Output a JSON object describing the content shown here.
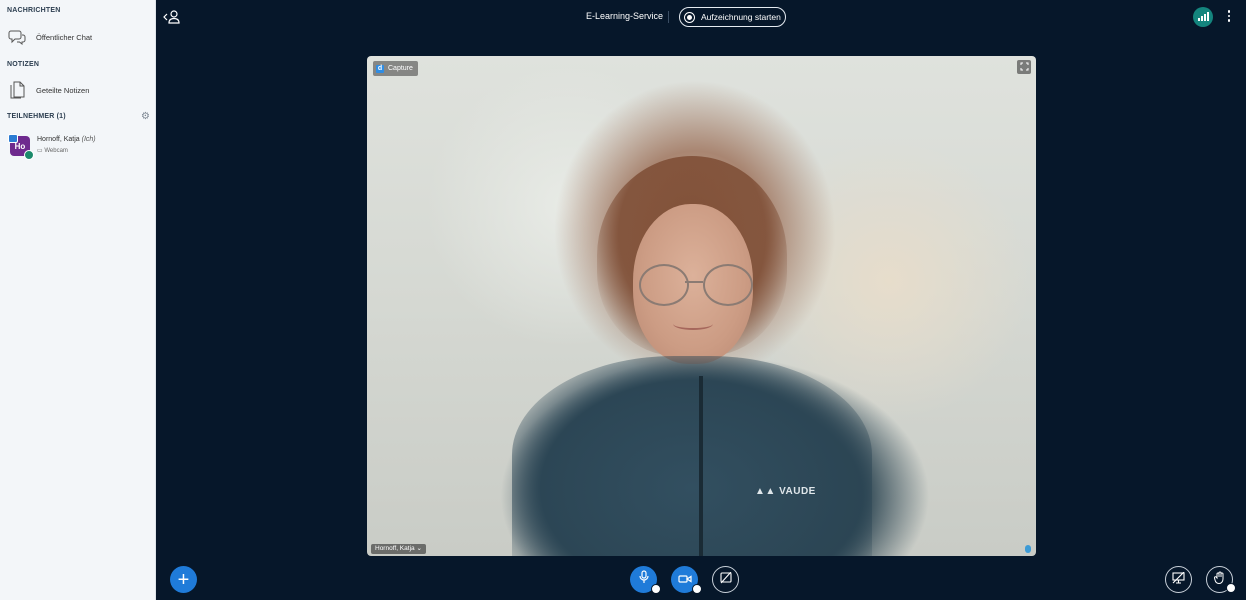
{
  "sidebar": {
    "messages_title": "NACHRICHTEN",
    "public_chat": "Öffentlicher Chat",
    "notes_title": "NOTIZEN",
    "shared_notes": "Geteilte Notizen",
    "participants_title": "TEILNEHMER (1)",
    "user": {
      "name": "Hornoff, Katja",
      "self_tag": "(Ich)",
      "initials": "Ho",
      "status": "Webcam"
    }
  },
  "topbar": {
    "title": "E-Learning-Service",
    "record_label": "Aufzeichnung starten"
  },
  "video": {
    "capture_label": "Capture",
    "capture_icon_letter": "d",
    "name_tag": "Hornoff, Katja",
    "brand_text": "VAUDE"
  },
  "colors": {
    "background": "#06172a",
    "sidebar": "#f3f6f9",
    "accent_blue": "#1f7bd9",
    "connection_teal": "#14857e",
    "avatar_purple": "#6e2a8e"
  },
  "icons": {
    "public_chat": "chat-bubbles-icon",
    "shared_notes": "document-icon",
    "participants_settings": "gear-icon",
    "toggle_userlist": "user-list-icon",
    "record": "record-icon",
    "connection": "signal-bars-icon",
    "options": "vertical-dots-icon",
    "fullscreen": "fullscreen-icon",
    "actions": "plus-icon",
    "microphone": "microphone-icon",
    "camera": "camera-icon",
    "screenshare": "screenshare-icon",
    "presentation": "presentation-icon",
    "raise_hand": "hand-icon"
  }
}
